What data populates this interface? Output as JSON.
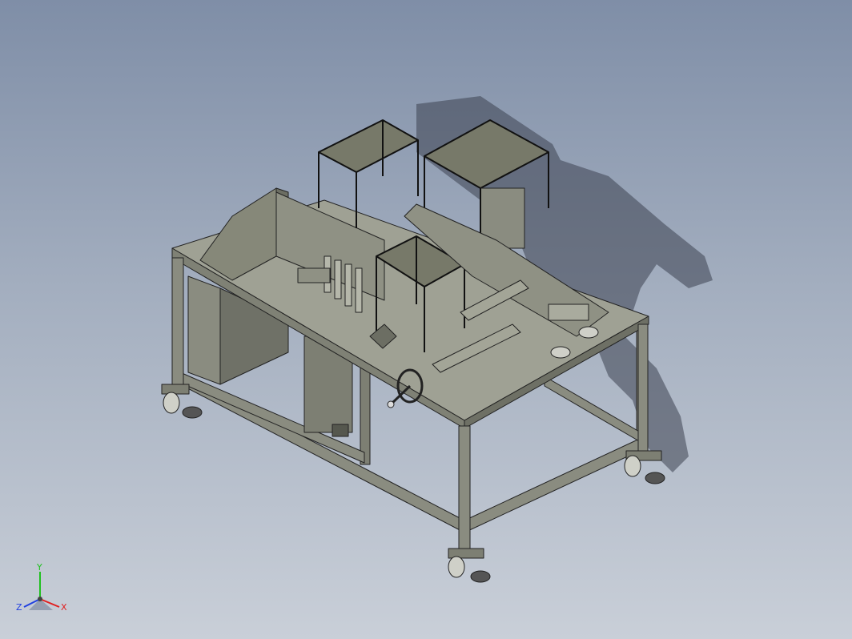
{
  "viewport": {
    "background_top": "#7f8ea7",
    "background_bottom": "#c9cfd8",
    "view_mode": "shaded-with-edges"
  },
  "model": {
    "description_icon": "machine-assembly-icon",
    "colors": {
      "body": "#8a8c80",
      "body_light": "#a3a597",
      "body_dark": "#6c6e63",
      "edge": "#222222",
      "shadow": "#3c4250"
    }
  },
  "triad": {
    "x_label": "X",
    "y_label": "Y",
    "z_label": "Z",
    "x_color": "#e02020",
    "y_color": "#20c020",
    "z_color": "#2040e0"
  }
}
